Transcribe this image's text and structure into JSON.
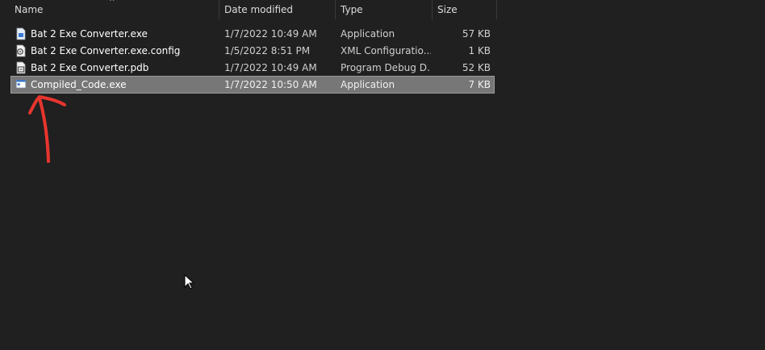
{
  "columns": {
    "name": "Name",
    "date": "Date modified",
    "type": "Type",
    "size": "Size"
  },
  "sort_indicator": "^",
  "files": [
    {
      "name": "Bat 2 Exe Converter.exe",
      "date": "1/7/2022 10:49 AM",
      "type": "Application",
      "size": "57 KB",
      "icon": "exe-file-icon"
    },
    {
      "name": "Bat 2 Exe Converter.exe.config",
      "date": "1/5/2022 8:51 PM",
      "type": "XML Configuratio...",
      "size": "1 KB",
      "icon": "config-file-icon"
    },
    {
      "name": "Bat 2 Exe Converter.pdb",
      "date": "1/7/2022 10:49 AM",
      "type": "Program Debug D...",
      "size": "52 KB",
      "icon": "pdb-file-icon"
    },
    {
      "name": "Compiled_Code.exe",
      "date": "1/7/2022 10:50 AM",
      "type": "Application",
      "size": "7 KB",
      "icon": "application-window-icon",
      "selected": true
    }
  ],
  "colors": {
    "background": "#202020",
    "selection": "#777777",
    "annotation": "#e8352e"
  }
}
